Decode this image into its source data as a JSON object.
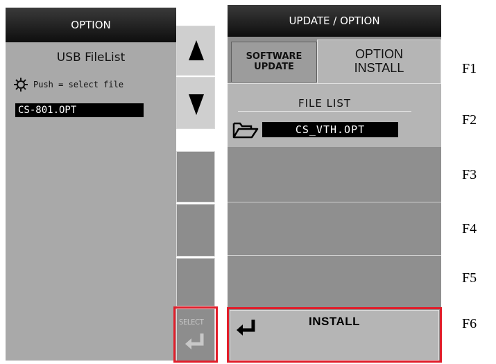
{
  "left_panel": {
    "header": "OPTION",
    "title": "USB FileList",
    "hint": "Push = select file",
    "file": "CS-801.OPT",
    "select_label": "SELECT"
  },
  "right_panel": {
    "header": "UPDATE / OPTION",
    "tabs": [
      "SOFTWARE\nUPDATE",
      "OPTION\nINSTALL"
    ],
    "file_list_title": "FILE LIST",
    "file": "CS_VTH.OPT",
    "install_label": "INSTALL"
  },
  "fkeys": [
    "F1",
    "F2",
    "F3",
    "F4",
    "F5",
    "F6"
  ],
  "colors": {
    "highlight_border": "#e11d2a"
  }
}
